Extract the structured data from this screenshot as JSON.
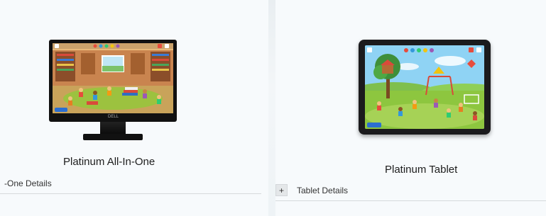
{
  "products": [
    {
      "title": "Platinum All-In-One",
      "details_label": "-One Details",
      "device_brand": "DELL",
      "screen_scene": "classroom"
    },
    {
      "title": "Platinum Tablet",
      "details_label": "Tablet Details",
      "expand_symbol": "+",
      "screen_scene": "playground"
    }
  ],
  "colors": {
    "background": "#eef2f4",
    "card": "#f7fafc",
    "divider": "#d6dadc",
    "device_frame": "#111111"
  },
  "icons": [
    "plus-icon"
  ]
}
